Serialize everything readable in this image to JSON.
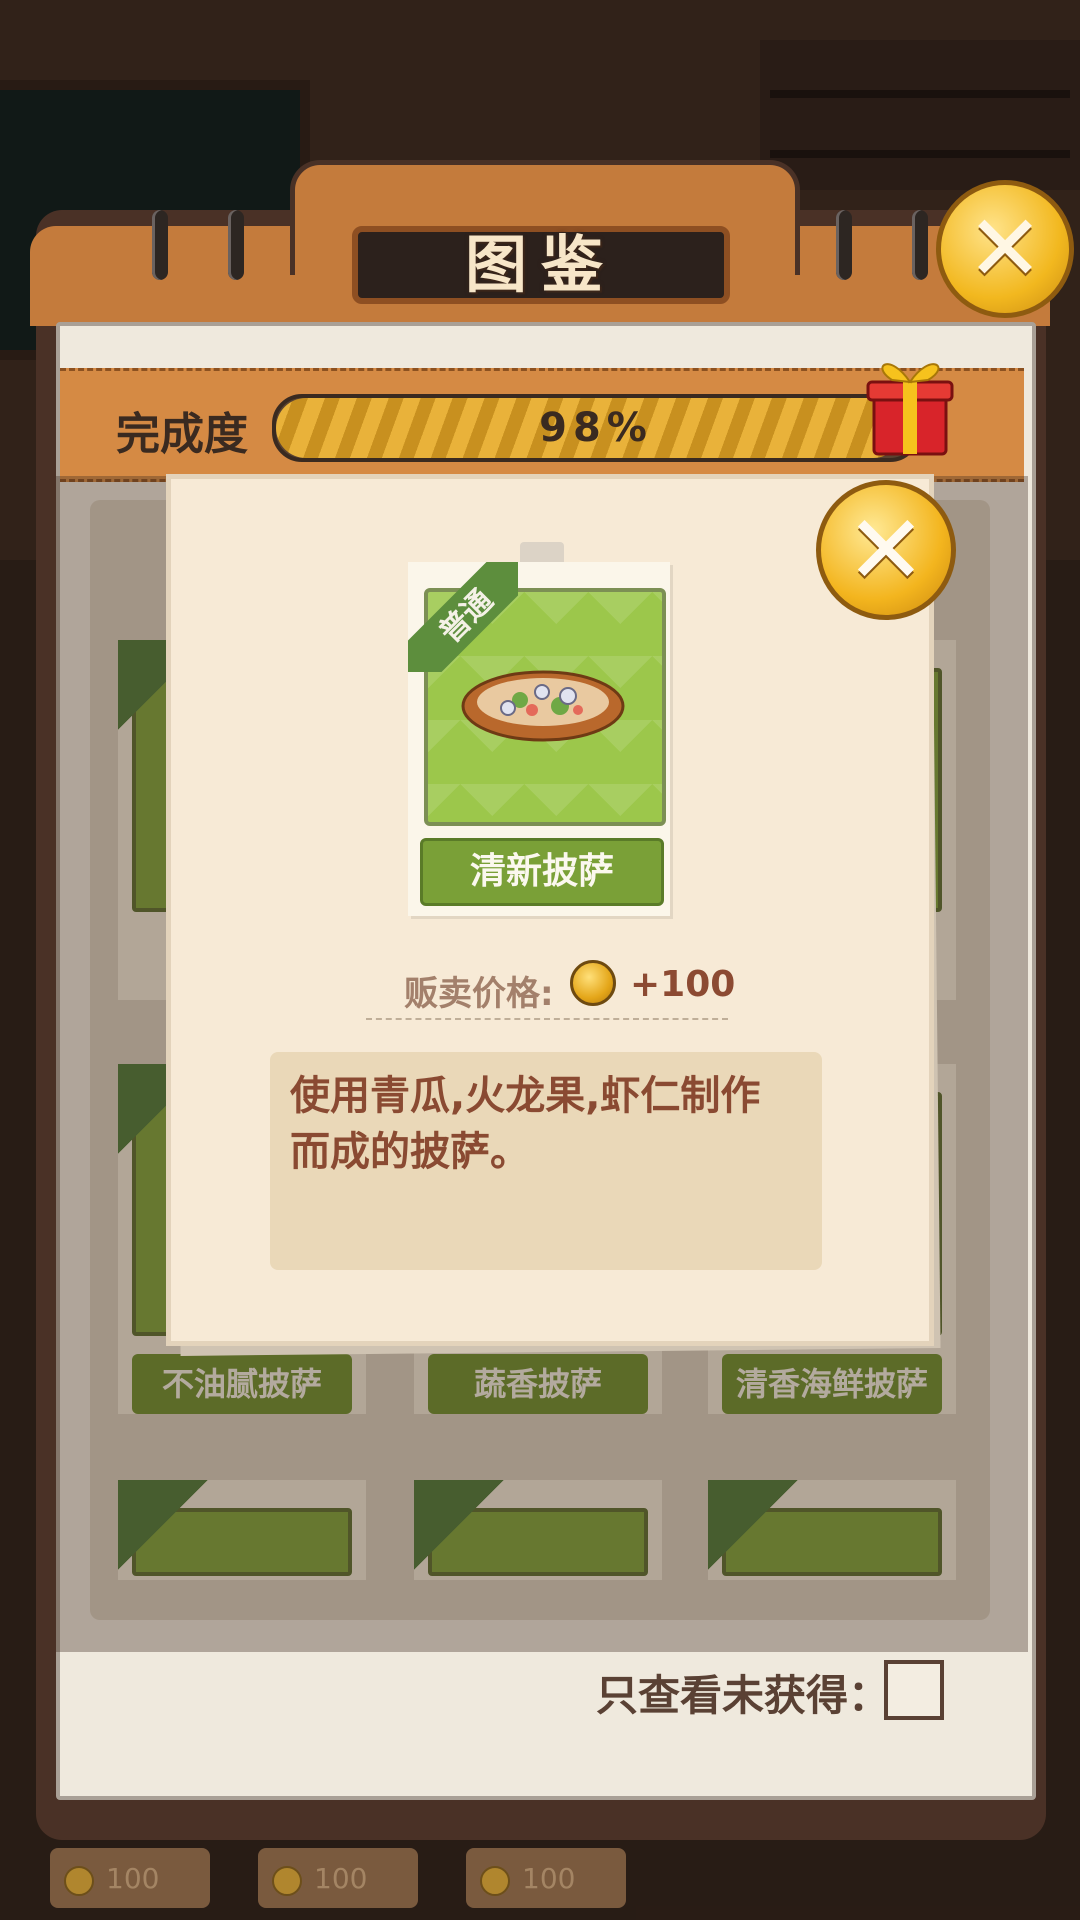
{
  "header": {
    "title": "图鉴"
  },
  "progress": {
    "label": "完成度",
    "value_text": "98%",
    "fraction": 0.98
  },
  "grid": {
    "visible_names": [
      "不油腻披萨",
      "蔬香披萨",
      "清香海鲜披萨"
    ],
    "rarity": "普通"
  },
  "filter": {
    "label": "只查看未获得：",
    "checked": false
  },
  "bottom_bar": {
    "prices": [
      "100",
      "100",
      "100"
    ]
  },
  "detail": {
    "rarity": "普通",
    "item_name": "清新披萨",
    "price_label": "贩卖价格:",
    "price_value": "+100",
    "description": "使用青瓜,火龙果,虾仁制作而成的披萨。"
  },
  "icons": {
    "close": "close-icon",
    "gift": "gift-icon",
    "coin": "coin-icon",
    "pizza": "pizza-icon"
  },
  "colors": {
    "accent_orange": "#c47b3c",
    "card_green": "#7aa037",
    "text_brown": "#8a4a32",
    "coin_gold": "#f2b81f"
  }
}
